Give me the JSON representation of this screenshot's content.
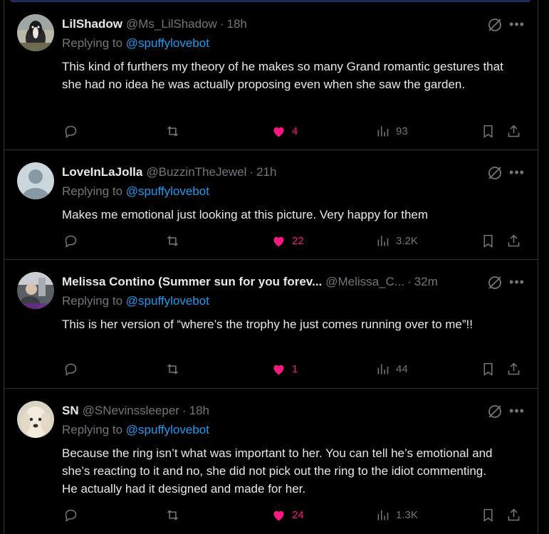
{
  "replies": [
    {
      "name": "LilShadow",
      "handle": "@Ms_LilShadow",
      "dot": "·",
      "time": "18h",
      "replying_prefix": "Replying to",
      "replying_to": "@spuffylovebot",
      "text": "This kind of furthers my theory of he makes so many Grand romantic gestures that she had no idea he was actually proposing even when she saw the garden.",
      "likes": "4",
      "views": "93",
      "liked": true,
      "avatar": "dog-avatar"
    },
    {
      "name": "LoveInLaJolla",
      "handle": "@BuzzinTheJewel",
      "dot": "·",
      "time": "21h",
      "replying_prefix": "Replying to",
      "replying_to": "@spuffylovebot",
      "text": "Makes me emotional just looking at this picture. Very happy for them",
      "likes": "22",
      "views": "3.2K",
      "liked": true,
      "avatar": "default-avatar"
    },
    {
      "name": "Melissa Contino (Summer sun for you forev...",
      "handle": "@Melissa_C...",
      "dot": "·",
      "time": "32m",
      "replying_prefix": "Replying to",
      "replying_to": "@spuffylovebot",
      "text": "This is her version of “where’s the trophy he just comes running over to me”!!",
      "likes": "1",
      "views": "44",
      "liked": true,
      "avatar": "photo-avatar"
    },
    {
      "name": "SN",
      "handle": "@SNevinssleeper",
      "dot": "·",
      "time": "18h",
      "replying_prefix": "Replying to",
      "replying_to": "@spuffylovebot",
      "text": "Because the ring isn’t what was important to her. You can tell he’s emotional and she’s reacting to it and no, she did not pick out the ring to the idiot commenting. He actually had it designed and made for her.",
      "likes": "24",
      "views": "1.3K",
      "liked": true,
      "avatar": "dog-avatar"
    }
  ],
  "colors": {
    "background": "#000000",
    "text": "#e7e9ea",
    "muted": "#71767b",
    "link": "#1d9bf0",
    "like": "#f91880",
    "border": "#2f3336"
  }
}
